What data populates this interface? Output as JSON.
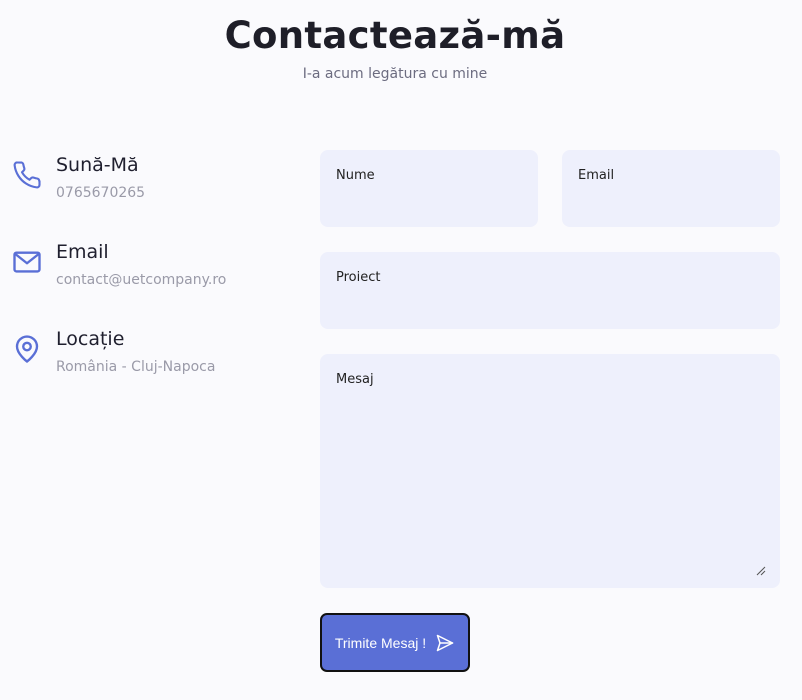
{
  "header": {
    "title": "Contactează-mă",
    "subtitle": "I-a acum legătura cu mine"
  },
  "contact_info": [
    {
      "icon": "phone-icon",
      "title": "Sună-Mă",
      "text": "0765670265"
    },
    {
      "icon": "mail-icon",
      "title": "Email",
      "text": "contact@uetcompany.ro"
    },
    {
      "icon": "map-pin-icon",
      "title": "Locație",
      "text": "România - Cluj-Napoca"
    }
  ],
  "form": {
    "name_label": "Nume",
    "email_label": "Email",
    "project_label": "Proiect",
    "message_label": "Mesaj",
    "submit_label": "Trimite Mesaj !"
  },
  "colors": {
    "accent": "#5a6fd6",
    "field_bg": "#eef0fc",
    "page_bg": "#fafafd"
  }
}
